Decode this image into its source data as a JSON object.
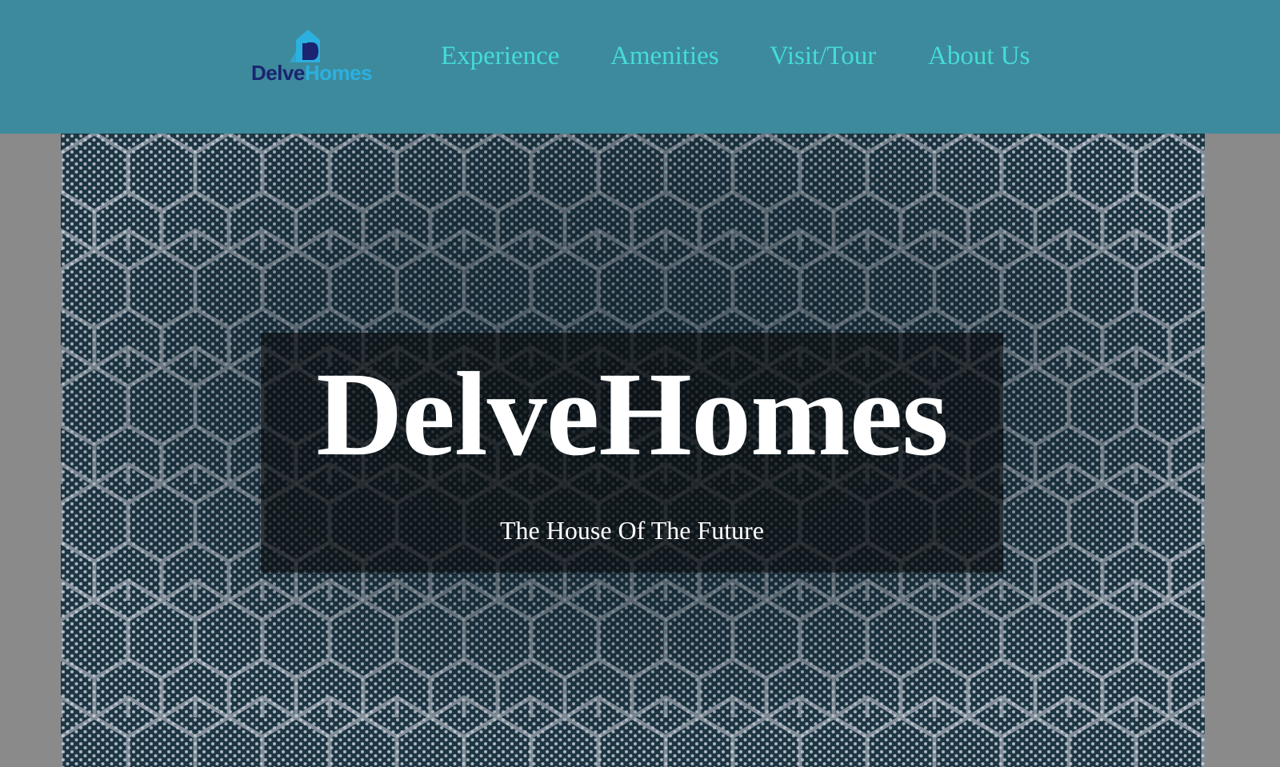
{
  "logo": {
    "part_a": "Delve",
    "part_b": "Homes",
    "icon": "house-logo-icon",
    "colors": {
      "dark": "#1a2470",
      "light": "#2bb0e0"
    }
  },
  "nav": {
    "items": [
      {
        "label": "Experience"
      },
      {
        "label": "Amenities"
      },
      {
        "label": "Visit/Tour"
      },
      {
        "label": "About Us"
      }
    ]
  },
  "hero": {
    "title": "DelveHomes",
    "subtitle": "The House Of The Future",
    "background": "hexagon-dot-pattern"
  },
  "colors": {
    "navbar": "#3d8a9c",
    "nav_link": "#45dcd5",
    "page_background": "#8a8a8a",
    "hero_text": "#ffffff"
  }
}
